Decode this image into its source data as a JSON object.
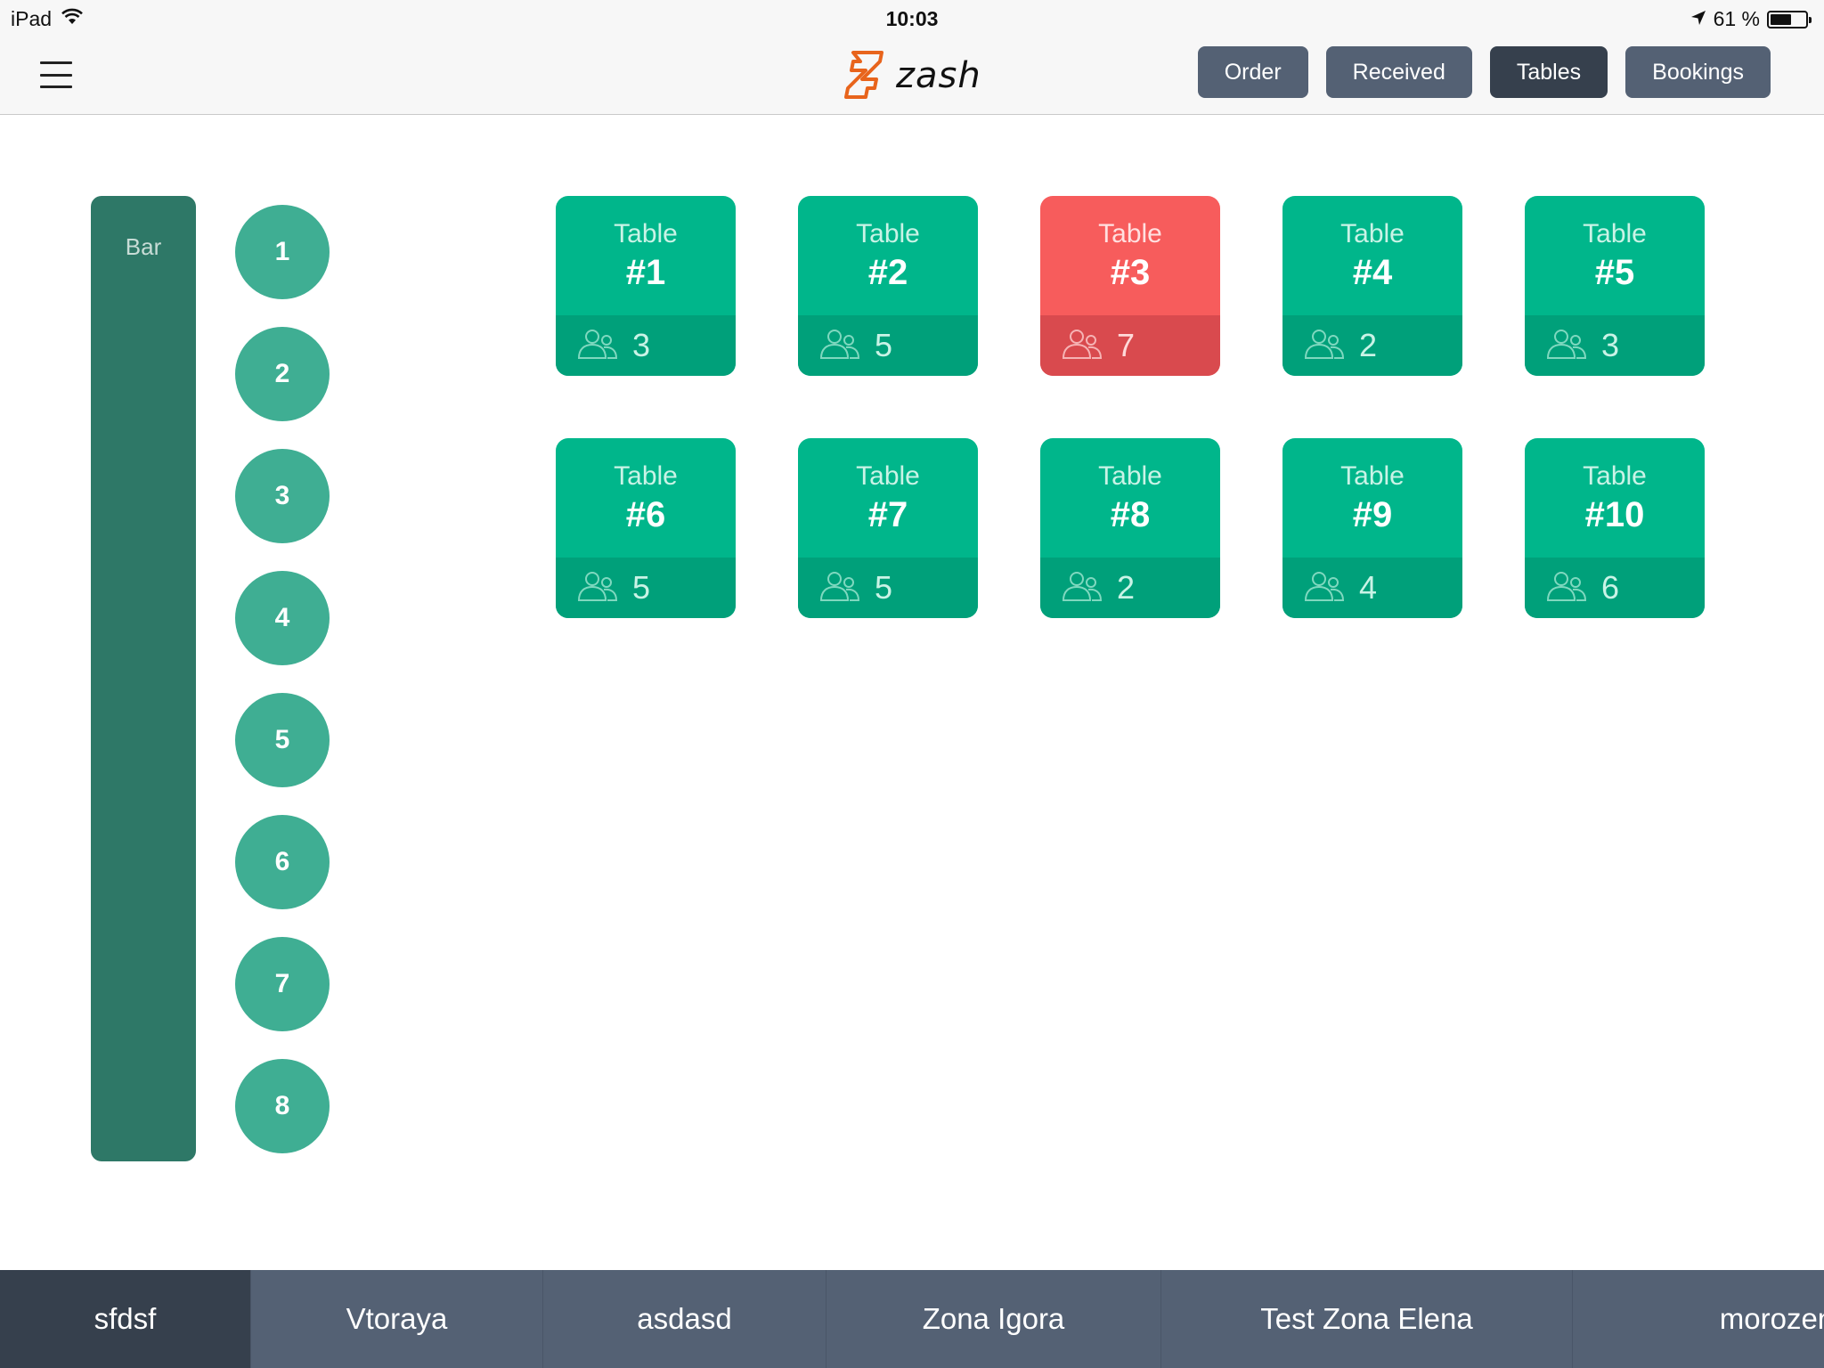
{
  "status_bar": {
    "device": "iPad",
    "time": "10:03",
    "battery": "61 %",
    "battery_level": 0.61
  },
  "nav": {
    "logo_text": "zash",
    "buttons": [
      {
        "label": "Order",
        "active": false
      },
      {
        "label": "Received",
        "active": false
      },
      {
        "label": "Tables",
        "active": true
      },
      {
        "label": "Bookings",
        "active": false
      }
    ]
  },
  "bar": {
    "label": "Bar",
    "seats": [
      "1",
      "2",
      "3",
      "4",
      "5",
      "6",
      "7",
      "8"
    ]
  },
  "tables": [
    {
      "word": "Table",
      "number": "#1",
      "guests": "3",
      "status": "free"
    },
    {
      "word": "Table",
      "number": "#2",
      "guests": "5",
      "status": "free"
    },
    {
      "word": "Table",
      "number": "#3",
      "guests": "7",
      "status": "occupied"
    },
    {
      "word": "Table",
      "number": "#4",
      "guests": "2",
      "status": "free"
    },
    {
      "word": "Table",
      "number": "#5",
      "guests": "3",
      "status": "free"
    },
    {
      "word": "Table",
      "number": "#6",
      "guests": "5",
      "status": "free"
    },
    {
      "word": "Table",
      "number": "#7",
      "guests": "5",
      "status": "free"
    },
    {
      "word": "Table",
      "number": "#8",
      "guests": "2",
      "status": "free"
    },
    {
      "word": "Table",
      "number": "#9",
      "guests": "4",
      "status": "free"
    },
    {
      "word": "Table",
      "number": "#10",
      "guests": "6",
      "status": "free"
    }
  ],
  "zones": [
    {
      "label": "sfdsf",
      "active": true
    },
    {
      "label": "Vtoraya",
      "active": false
    },
    {
      "label": "asdasd",
      "active": false
    },
    {
      "label": "Zona Igora",
      "active": false
    },
    {
      "label": "Test Zona Elena",
      "active": false
    },
    {
      "label": "morozenki",
      "active": false
    }
  ],
  "colors": {
    "table_free": "#00b68b",
    "table_occupied": "#f75c5c",
    "seat": "#3fae93",
    "bar": "#2e7867",
    "nav_button": "#546174",
    "nav_button_active": "#36404d",
    "logo_accent": "#e8641c"
  },
  "icons": {
    "menu": "hamburger-icon",
    "wifi": "wifi-icon",
    "location": "location-arrow-icon",
    "battery": "battery-icon",
    "guests": "people-icon"
  }
}
